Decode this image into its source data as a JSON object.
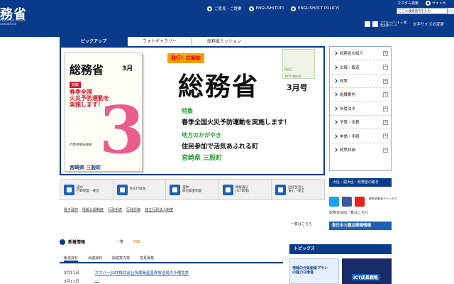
{
  "header": {
    "logo": "務省",
    "logo_sub_1": "f Internal Affairs",
    "logo_sub_2": "unications",
    "links": [
      "ご意見・ご提案",
      "ENGLISH(TOP)",
      "ENGLISH(ICT POLICY)"
    ],
    "google_label": "カスタム検索",
    "sitemap": "サイトH",
    "search_placeholder": "ここに検索語句を入力",
    "accessibility_tool": "アクセシビリティ 閲覧支援ツール",
    "font_size_label": "文字サイズの変更"
  },
  "tabs": [
    "ピックアップ",
    "フォトギャラリー",
    "総務省ミッション"
  ],
  "banner": {
    "mag_title": "総務省",
    "mag_month": "3月",
    "mag_badge": "特集",
    "mag_head_1": "春季全国",
    "mag_head_2": "火災予防運動を",
    "mag_head_3": "実施します！",
    "mag_line_1": "行政評価局調査",
    "mag_local": "宮崎県 三股町",
    "pub_badge": "発行！広報誌",
    "big_title": "総務省",
    "issue": "3月号",
    "mic": "MIC",
    "mic_date": "2015 March",
    "tok_label": "特集",
    "tok_text": "春季全国火災予防運動を実施します！",
    "loc_label": "地方のかがやき",
    "loc_text": "住民参加で活気あふれる町",
    "loc_place": "宮崎県 三股町"
  },
  "right_nav": [
    "総務省の紹介",
    "広報・報道",
    "政策",
    "組織案内",
    "所管法令",
    "予算・決算",
    "申請・手続",
    "政策評価"
  ],
  "icon_row": [
    {
      "l1": "国の",
      "l2": "行政制度・運営"
    },
    {
      "l1": "地方行財政",
      "l2": ""
    },
    {
      "l1": "選挙",
      "l2": "政治資金制度"
    },
    {
      "l1": "情報通信",
      "l2": "(ICT政策)"
    },
    {
      "l1": "国民生活と",
      "l2": "安心・安全"
    }
  ],
  "quicklinks": [
    "電子政府",
    "情報公開制度",
    "行政手続",
    "行政評価",
    "独立行政法人制度"
  ],
  "ichiran_mission": "一覧はこちら",
  "news": {
    "title": "新着情報",
    "ichiran": "一覧",
    "rss": "RSS",
    "tabs": [
      "報道資料",
      "会議資料",
      "開催案内等",
      "意見募集"
    ],
    "rows": [
      {
        "date": "3月11日",
        "text": "スカパーJSAT株式会社所属衛星基幹放送局の予備免許"
      },
      {
        "date": "3月11日",
        "text": "…"
      }
    ]
  },
  "right_lower": {
    "minister": "大臣・副大臣・政務官の動き",
    "sns_label": "総務省動画チャンネル",
    "sns_link": "総務省SNS一覧はこちら",
    "disaster": "東日本大震災関連情報",
    "topics": "トピックス",
    "topic1_l1": "地域の元気創造プラン",
    "topic1_l2": "の強力な推進",
    "topic2": "ICT成長戦略"
  },
  "colors": {
    "primary": "#0a3a8a",
    "accent": "#1d62b5",
    "highlight": "#2aa03a"
  }
}
